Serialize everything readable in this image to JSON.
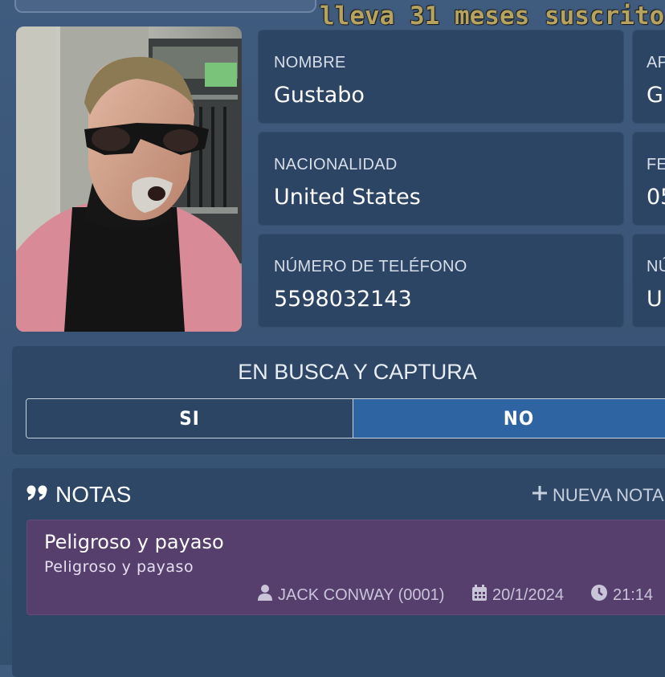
{
  "subscription_banner": "lleva 31 meses suscrito",
  "profile": {
    "name": {
      "label": "NOMBRE",
      "value": "Gustabo"
    },
    "nationality": {
      "label": "NACIONALIDAD",
      "value": "United States"
    },
    "phone": {
      "label": "NÚMERO DE TELÉFONO",
      "value": "5598032143"
    },
    "partial_right": [
      {
        "label": "AP",
        "value": "G"
      },
      {
        "label": "FE",
        "value": "05"
      },
      {
        "label": "NÚ",
        "value": "U"
      }
    ]
  },
  "wanted": {
    "title": "EN BUSCA Y CAPTURA",
    "options": [
      "SI",
      "NO"
    ],
    "selected": "NO"
  },
  "notes": {
    "title": "NOTAS",
    "new_note_label": "NUEVA NOTA",
    "items": [
      {
        "title": "Peligroso y payaso",
        "body": "Peligroso y payaso",
        "author": "JACK CONWAY (0001)",
        "date": "20/1/2024",
        "time": "21:14"
      }
    ]
  },
  "colors": {
    "accent_selected": "#2e64a1",
    "card_bg": "#2c4565",
    "note_bg": "#563e6d",
    "banner_gold": "#b6a35f"
  },
  "icons": [
    "quote-icon",
    "plus-icon",
    "user-icon",
    "calendar-icon",
    "clock-icon"
  ]
}
